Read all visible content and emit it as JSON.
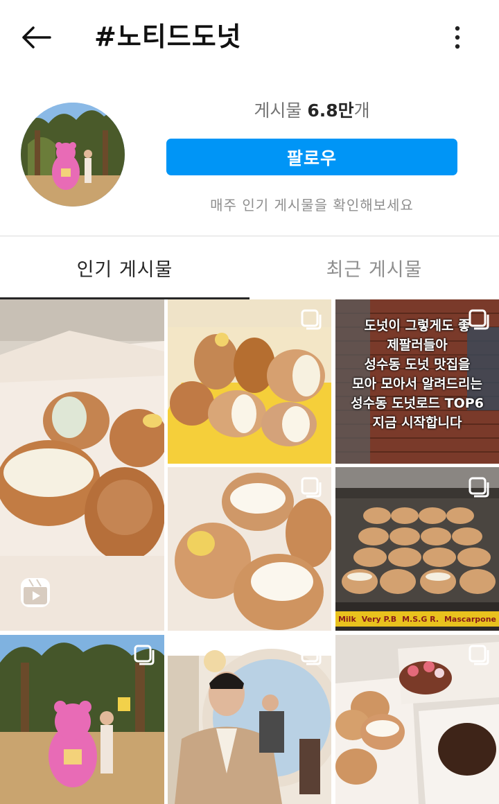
{
  "header": {
    "back_icon": "arrow-left-icon",
    "title": "#노티드도넛",
    "more_icon": "more-vertical-icon"
  },
  "profile": {
    "posts_label": "게시물",
    "posts_count": "6.8만",
    "posts_suffix": "개",
    "follow_label": "팔로우",
    "hint": "매주 인기 게시물을 확인해보세요"
  },
  "tabs": [
    {
      "label": "인기 게시물",
      "active": true
    },
    {
      "label": "최근 게시물",
      "active": false
    }
  ],
  "grid": {
    "overlay_lines": [
      "도넛이 그렇게도 좋",
      "제팔러들아",
      "성수동 도넛 맛집을",
      "모아 모아서 알려드리는",
      "성수동 도넛로드 TOP6",
      "지금 시작합니다"
    ],
    "tray_labels": [
      "Milk",
      "Very P.B",
      "M.S.G R.",
      "Mascarpone"
    ],
    "multi_icon": "carousel-icon",
    "reel_icon": "reels-icon"
  }
}
